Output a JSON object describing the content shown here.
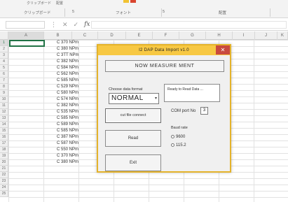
{
  "ribbon": {
    "tab_left": "クリップボード",
    "tab_left2": "配置",
    "group1": "クリップボード",
    "group2": "5",
    "group3": "フォント",
    "group4": "配置",
    "group5": "5"
  },
  "formula_bar": {
    "name_box": "",
    "cancel_icon": "close-icon",
    "confirm_icon": "check-icon",
    "fx_label": "fx"
  },
  "grid": {
    "column_headers": [
      "A",
      "B",
      "C",
      "D",
      "E",
      "F",
      "G",
      "H",
      "I",
      "J",
      "K"
    ],
    "row_headers": [
      "1",
      "2",
      "3",
      "4",
      "5",
      "6",
      "7",
      "8",
      "9",
      "10",
      "11",
      "12",
      "13",
      "14",
      "15",
      "16",
      "17",
      "18",
      "19",
      "20",
      "21",
      "22",
      "23",
      "24",
      "25"
    ],
    "column_b_values": [
      "C 370 NPm",
      "C 380 NPm",
      "C 3TT NPm",
      "C 382 NPm",
      "C 584 NPm",
      "C 562 NPm",
      "C 585 NPm",
      "C 529 NPm",
      "C 580 NPm",
      "C 574 NPm",
      "C 382 NPm",
      "C 535 NPm",
      "C 585 NPm",
      "C 589 NPm",
      "C 585 NPm",
      "C 387 NPm",
      "C 587 NPm",
      "C 550 NPm",
      "C 370 NPm",
      "C 380 NPm"
    ]
  },
  "dialog": {
    "title": "I2 DAP Data Import v1.0",
    "now_measurement_button": "NOW MEASURE MENT",
    "status_text": "Ready to Read Data ...",
    "format_label": "Choose data format",
    "format_value": "NORMAL",
    "cut_button": "cut file connect",
    "channel_label": "COM port No",
    "channel_value": "3",
    "baud_label": "Baud rate",
    "baud_options": [
      "9600",
      "115.2"
    ],
    "read_button": "Read",
    "exit_button": "Exit"
  }
}
